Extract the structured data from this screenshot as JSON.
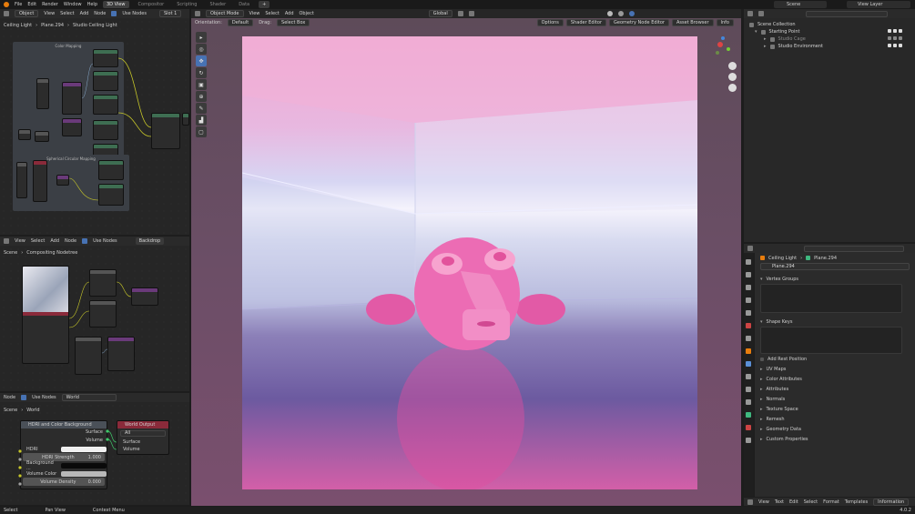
{
  "topbar": {
    "menus": [
      "File",
      "Edit",
      "Render",
      "Window",
      "Help"
    ],
    "workspaces": [
      "3D View",
      "Compositor",
      "Scripting",
      "Shader",
      "Data"
    ],
    "active_workspace": "3D View",
    "scene_label": "Scene",
    "view_layer_label": "View Layer"
  },
  "shader_editor": {
    "header": {
      "mode": "Object",
      "menus": [
        "View",
        "Select",
        "Add",
        "Node"
      ],
      "use_nodes": "Use Nodes",
      "slot": "Slot 1"
    },
    "breadcrumb": [
      "Ceiling Light",
      "Plane.294",
      "Studio Ceiling Light"
    ],
    "frame1_label": "Color Mapping",
    "frame2_label": "Spherical Circular Mapping"
  },
  "compositor": {
    "header": {
      "menus": [
        "View",
        "Select",
        "Add",
        "Node"
      ],
      "use_nodes": "Use Nodes",
      "backdrop": "Backdrop"
    },
    "breadcrumb": [
      "Scene",
      "Compositing Nodetree"
    ]
  },
  "world_editor": {
    "header": {
      "prefix": "Node",
      "use_nodes": "Use Nodes",
      "world": "World"
    },
    "breadcrumb": [
      "Scene",
      "World"
    ],
    "hdri_node": {
      "title": "HDRI and Color Background",
      "outputs": [
        "Surface",
        "Volume"
      ],
      "inputs": [
        {
          "label": "HDRI",
          "value": ""
        },
        {
          "label": "HDRI Strength",
          "value": "1.000"
        },
        {
          "label": "Background ...",
          "value": ""
        },
        {
          "label": "Volume Color",
          "value": ""
        },
        {
          "label": "Volume Density",
          "value": "0.000"
        }
      ]
    },
    "output_node": {
      "title": "World Output",
      "target": "All",
      "inputs": [
        "Surface",
        "Volume"
      ]
    }
  },
  "viewport": {
    "header": {
      "mode": "Object Mode",
      "menus": [
        "View",
        "Select",
        "Add",
        "Object"
      ],
      "transform": "Global"
    },
    "subheader": {
      "orientation_label": "Orientation:",
      "orientation": "Default",
      "drag_label": "Drag:",
      "drag": "Select Box"
    },
    "right_buttons": [
      "Options",
      "Shader Editor",
      "Geometry Node Editor",
      "Asset Browser",
      "Info"
    ]
  },
  "outliner": {
    "root": "Scene Collection",
    "items": [
      {
        "name": "Starting Point",
        "level": 1
      },
      {
        "name": "Studio Cage",
        "level": 2
      },
      {
        "name": "Studio Environment",
        "level": 2
      }
    ]
  },
  "properties": {
    "breadcrumb": [
      "Ceiling Light",
      "Plane.294"
    ],
    "mesh_name": "Plane.294",
    "sections_open": [
      "Vertex Groups",
      "Shape Keys"
    ],
    "add_rest_position": "Add Rest Position",
    "sections_closed": [
      "UV Maps",
      "Color Attributes",
      "Attributes",
      "Normals",
      "Texture Space",
      "Remesh",
      "Geometry Data",
      "Custom Properties"
    ]
  },
  "text_editor": {
    "menus": [
      "View",
      "Text",
      "Edit",
      "Select",
      "Format",
      "Templates"
    ],
    "info": "Information"
  },
  "statusbar": {
    "items": [
      "Select",
      "Pan View",
      "Context Menu"
    ],
    "version": "4.0.2"
  },
  "colors": {
    "accent": "#4772b3",
    "node_green": "#3e6e52",
    "node_red": "#8a2a3a",
    "node_purple": "#6a3a7a",
    "socket_yellow": "#c7c729",
    "pink": "#e85aa8"
  }
}
